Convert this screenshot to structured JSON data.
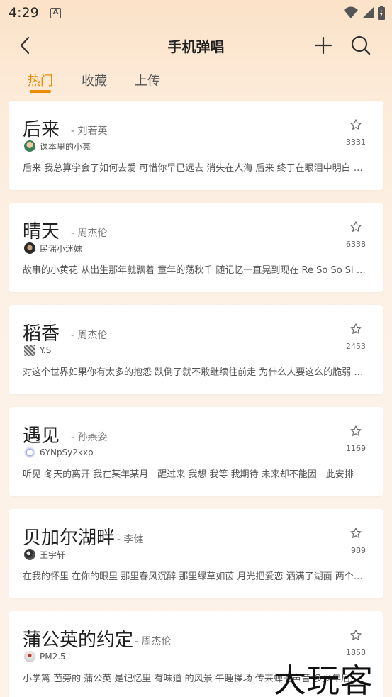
{
  "status_bar": {
    "time": "4:29",
    "notification_icon": "A"
  },
  "header": {
    "title": "手机弹唱",
    "back_icon": "chevron-left-icon",
    "add_icon": "plus-icon",
    "search_icon": "search-icon"
  },
  "tabs": [
    {
      "label": "热门",
      "active": true
    },
    {
      "label": "收藏",
      "active": false
    },
    {
      "label": "上传",
      "active": false
    }
  ],
  "colors": {
    "accent": "#f08a00"
  },
  "songs": [
    {
      "title": "后来",
      "artist": "刘若英",
      "uploader": "课本里的小亮",
      "count": "3331",
      "lyrics": "后来 我总算学会了如何去爱 可惜你早已远去 消失在人海 后来 终于在眼泪中明白 有些人 一旦错过就不再"
    },
    {
      "title": "晴天",
      "artist": "周杰伦",
      "uploader": "民谣小迷妹",
      "count": "6338",
      "lyrics": "故事的小黄花 从出生那年就飘着 童年的荡秋千 随记忆一直晃到现在 Re So So Si Do Si La"
    },
    {
      "title": "稻香",
      "artist": "周杰伦",
      "uploader": "Y.S",
      "count": "2453",
      "lyrics": "对这个世界如果你有太多的抱怨 跌倒了就不敢继续往前走 为什么人要这么的脆弱 堕落"
    },
    {
      "title": "遇见",
      "artist": "孙燕姿",
      "uploader": "6YNpSy2kxp",
      "count": "1169",
      "lyrics": "听见 冬天的离开 我在某年某月　醒过来 我想 我等 我期待 未来却不能因　此安排"
    },
    {
      "title": "贝加尔湖畔",
      "artist": "李健",
      "uploader": "王宇轩",
      "count": "989",
      "lyrics": "在我的怀里 在你的眼里 那里春风沉醉 那里绿草如茵 月光把爱恋 洒满了湖面 两个人的篝火"
    },
    {
      "title": "蒲公英的约定",
      "artist": "周杰伦",
      "uploader": "PM2.5",
      "count": "1858",
      "lyrics": "小学篱 芭旁的 蒲公英 是记忆里 有味道 的风景 午睡操场 传来蝉的声音 多少年后也还是很好听"
    }
  ],
  "watermark": "大玩客"
}
